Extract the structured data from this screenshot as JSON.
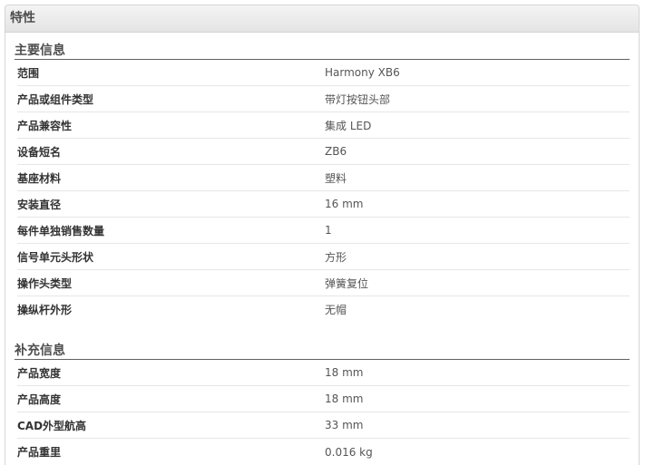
{
  "panel": {
    "title": "特性"
  },
  "sections": [
    {
      "title": "主要信息",
      "rows": [
        {
          "label": "范围",
          "value": "Harmony XB6"
        },
        {
          "label": "产品或组件类型",
          "value": "带灯按钮头部"
        },
        {
          "label": "产品兼容性",
          "value": "集成 LED"
        },
        {
          "label": "设备短名",
          "value": "ZB6"
        },
        {
          "label": "基座材料",
          "value": "塑料"
        },
        {
          "label": "安装直径",
          "value": "16 mm"
        },
        {
          "label": "每件单独销售数量",
          "value": "1"
        },
        {
          "label": "信号单元头形状",
          "value": "方形"
        },
        {
          "label": "操作头类型",
          "value": "弹簧复位"
        },
        {
          "label": "操纵杆外形",
          "value": "无帽"
        }
      ]
    },
    {
      "title": "补充信息",
      "rows": [
        {
          "label": "产品宽度",
          "value": "18 mm"
        },
        {
          "label": "产品高度",
          "value": "18 mm"
        },
        {
          "label": "CAD外型航高",
          "value": "33 mm"
        },
        {
          "label": "产品重里",
          "value": "0.016 kg"
        }
      ]
    }
  ]
}
